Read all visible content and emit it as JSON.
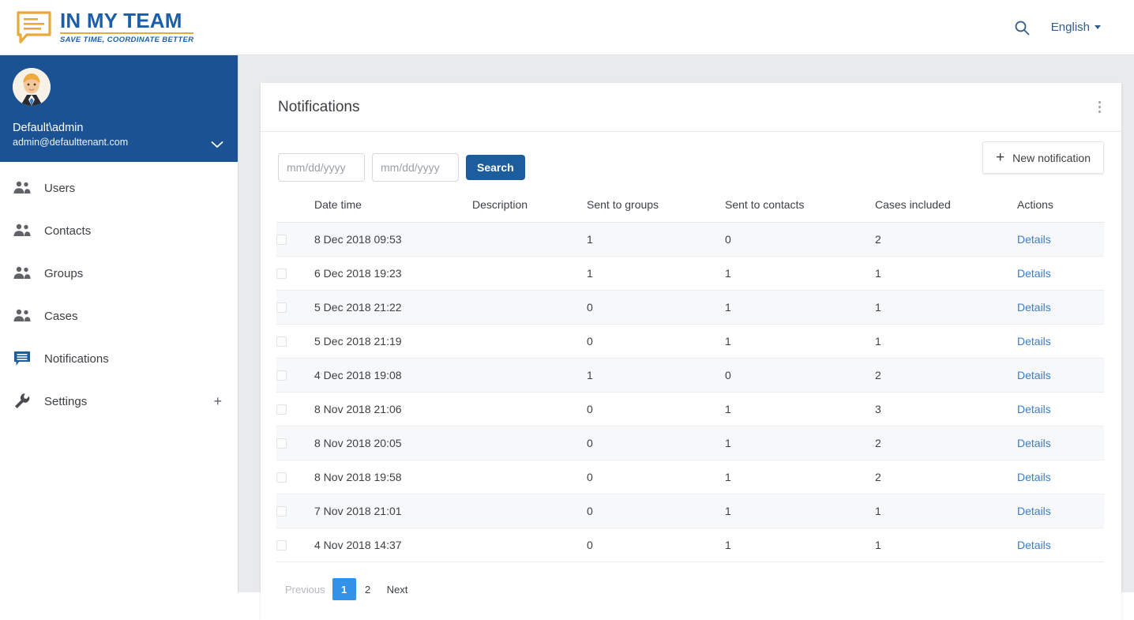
{
  "brand": {
    "title": "IN MY TEAM",
    "tagline": "SAVE TIME, COORDINATE BETTER",
    "logo_icon": "speech-bubble-icon",
    "primary_color": "#1c5ea8",
    "accent_color": "#e8a83a"
  },
  "topbar": {
    "search_icon": "search-icon",
    "language_label": "English",
    "language_caret_icon": "chevron-down-icon"
  },
  "sidebar": {
    "user": {
      "name": "Default\\admin",
      "email": "admin@defaulttenant.com",
      "avatar_icon": "avatar",
      "expand_icon": "chevron-down-icon",
      "background_color": "#1b5293"
    },
    "items": [
      {
        "label": "Users",
        "icon": "people-icon",
        "active": false
      },
      {
        "label": "Contacts",
        "icon": "people-icon",
        "active": false
      },
      {
        "label": "Groups",
        "icon": "people-icon",
        "active": false
      },
      {
        "label": "Cases",
        "icon": "people-icon",
        "active": false
      },
      {
        "label": "Notifications",
        "icon": "notification-icon",
        "active": true
      },
      {
        "label": "Settings",
        "icon": "wrench-icon",
        "active": false,
        "trailing": "+"
      }
    ]
  },
  "card": {
    "title": "Notifications",
    "menu_icon": "kebab-menu-icon"
  },
  "toolbar": {
    "date_from_value": "",
    "date_from_placeholder": "mm/dd/yyyy",
    "date_to_value": "",
    "date_to_placeholder": "mm/dd/yyyy",
    "search_label": "Search",
    "search_button_color": "#1c5d9e",
    "new_notification_label": "New notification",
    "new_notification_icon": "plus-icon"
  },
  "table": {
    "columns": [
      "",
      "Date time",
      "Description",
      "Sent to groups",
      "Sent to contacts",
      "Cases included",
      "Actions"
    ],
    "action_label": "Details",
    "rows": [
      {
        "date": "8 Dec 2018 09:53",
        "description": "",
        "sent_to_groups": "1",
        "sent_to_contacts": "0",
        "cases_included": "2",
        "action": "Details"
      },
      {
        "date": "6 Dec 2018 19:23",
        "description": "",
        "sent_to_groups": "1",
        "sent_to_contacts": "1",
        "cases_included": "1",
        "action": "Details"
      },
      {
        "date": "5 Dec 2018 21:22",
        "description": "",
        "sent_to_groups": "0",
        "sent_to_contacts": "1",
        "cases_included": "1",
        "action": "Details"
      },
      {
        "date": "5 Dec 2018 21:19",
        "description": "",
        "sent_to_groups": "0",
        "sent_to_contacts": "1",
        "cases_included": "1",
        "action": "Details"
      },
      {
        "date": "4 Dec 2018 19:08",
        "description": "",
        "sent_to_groups": "1",
        "sent_to_contacts": "0",
        "cases_included": "2",
        "action": "Details"
      },
      {
        "date": "8 Nov 2018 21:06",
        "description": "",
        "sent_to_groups": "0",
        "sent_to_contacts": "1",
        "cases_included": "3",
        "action": "Details"
      },
      {
        "date": "8 Nov 2018 20:05",
        "description": "",
        "sent_to_groups": "0",
        "sent_to_contacts": "1",
        "cases_included": "2",
        "action": "Details"
      },
      {
        "date": "8 Nov 2018 19:58",
        "description": "",
        "sent_to_groups": "0",
        "sent_to_contacts": "1",
        "cases_included": "2",
        "action": "Details"
      },
      {
        "date": "7 Nov 2018 21:01",
        "description": "",
        "sent_to_groups": "0",
        "sent_to_contacts": "1",
        "cases_included": "1",
        "action": "Details"
      },
      {
        "date": "4 Nov 2018 14:37",
        "description": "",
        "sent_to_groups": "0",
        "sent_to_contacts": "1",
        "cases_included": "1",
        "action": "Details"
      }
    ]
  },
  "pagination": {
    "previous_label": "Previous",
    "next_label": "Next",
    "pages": [
      "1",
      "2"
    ],
    "current_page": "1",
    "active_color": "#3391e8"
  }
}
